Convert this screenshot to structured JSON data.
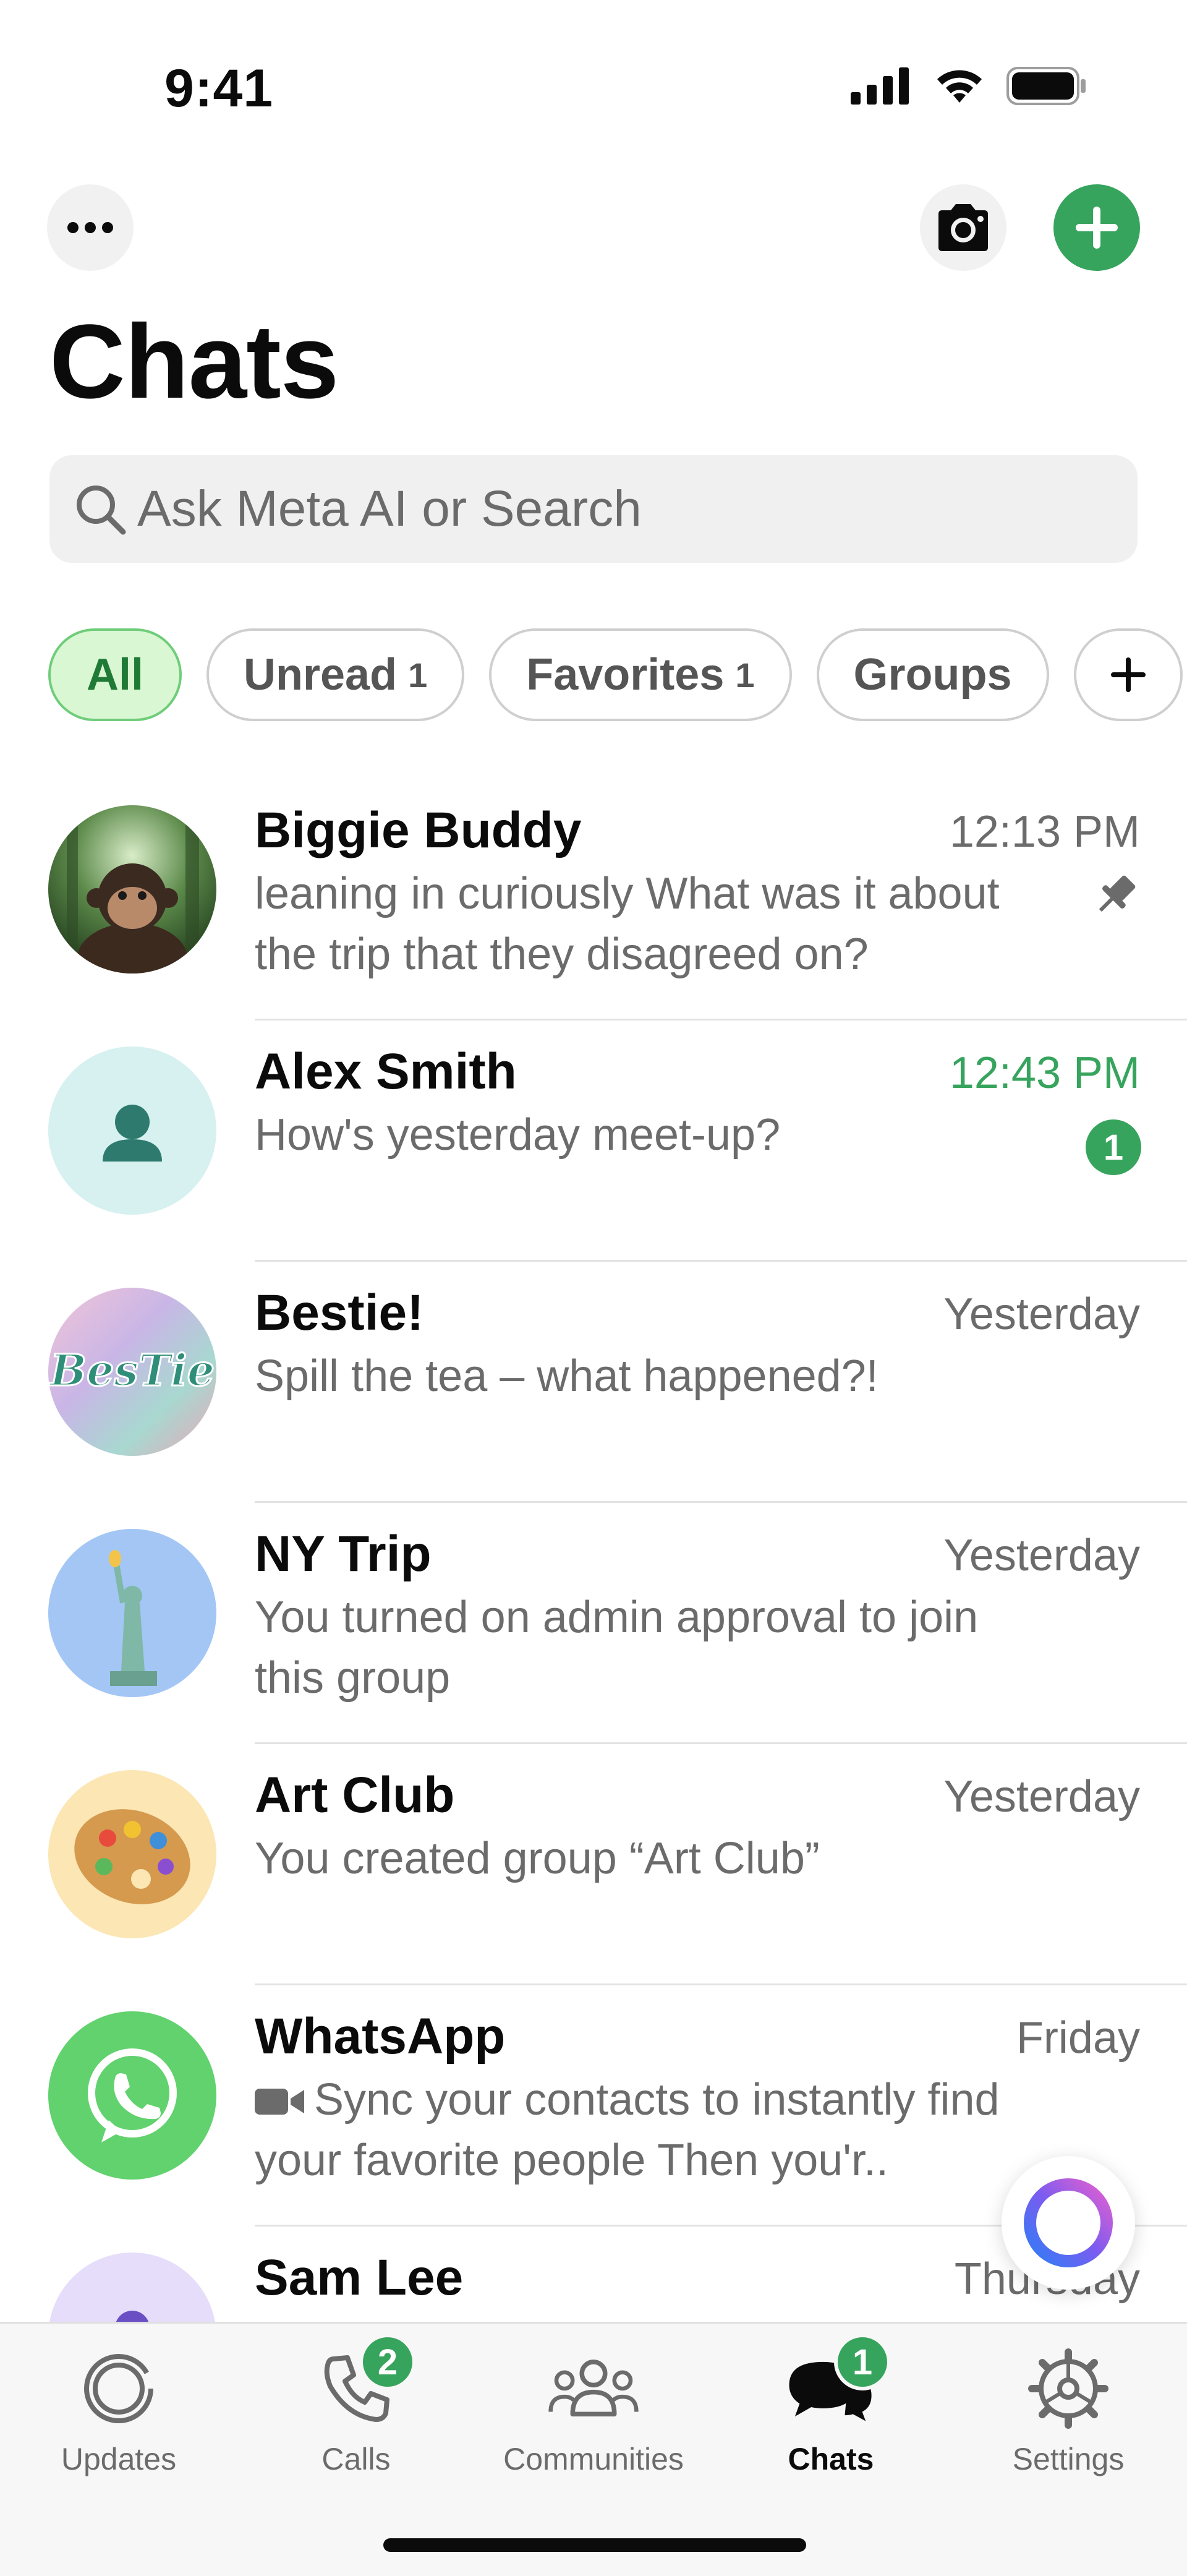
{
  "status_bar": {
    "time": "9:41"
  },
  "header": {
    "title": "Chats",
    "more_icon": "ellipsis-icon",
    "camera_icon": "camera-icon",
    "compose_icon": "plus-icon"
  },
  "search": {
    "placeholder": "Ask Meta AI or Search"
  },
  "filters": [
    {
      "label": "All",
      "count": "",
      "active": true
    },
    {
      "label": "Unread",
      "count": "1",
      "active": false
    },
    {
      "label": "Favorites",
      "count": "1",
      "active": false
    },
    {
      "label": "Groups",
      "count": "",
      "active": false
    }
  ],
  "chats": [
    {
      "name": "Biggie Buddy",
      "time": "12:13 PM",
      "preview": "leaning in curiously What was it about the trip that they disagreed on?",
      "pinned": true
    },
    {
      "name": "Alex Smith",
      "time": "12:43 PM",
      "preview": "How's yesterday meet-up?",
      "unread_count": "1"
    },
    {
      "name": "Bestie!",
      "time": "Yesterday",
      "preview": "Spill the tea – what happened?!"
    },
    {
      "name": "NY Trip",
      "time": "Yesterday",
      "preview": "You turned on admin approval to join this group"
    },
    {
      "name": "Art Club",
      "time": "Yesterday",
      "preview": "You created group “Art Club”"
    },
    {
      "name": "WhatsApp",
      "time": "Friday",
      "preview": "Sync your contacts to instantly find your favorite people Then you'r..",
      "preview_icon": "video-camera-icon"
    },
    {
      "name": "Sam Lee",
      "time": "Thursday",
      "preview": ""
    }
  ],
  "avatar_text": {
    "bestie": "BesTie"
  },
  "colors": {
    "accent_green": "#37a45d",
    "chip_active_bg": "#d9f7d3",
    "muted_text": "#6b6b6b"
  },
  "tabs": [
    {
      "label": "Updates",
      "icon": "updates-icon",
      "badge": ""
    },
    {
      "label": "Calls",
      "icon": "phone-icon",
      "badge": "2"
    },
    {
      "label": "Communities",
      "icon": "communities-icon",
      "badge": ""
    },
    {
      "label": "Chats",
      "icon": "chats-icon",
      "badge": "1",
      "active": true
    },
    {
      "label": "Settings",
      "icon": "gear-icon",
      "badge": ""
    }
  ]
}
